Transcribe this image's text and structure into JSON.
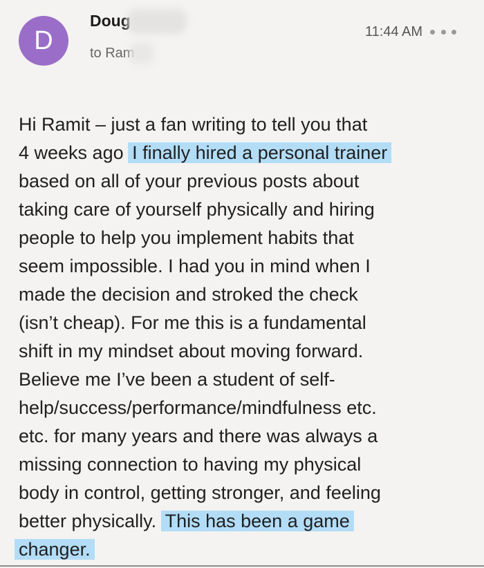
{
  "email": {
    "avatar_letter": "D",
    "sender_name": "Doug",
    "recipient": "to Ram",
    "time": "11:44 AM",
    "body_lines": [
      {
        "text": "Hi Ramit – just a fan writing to tell you that",
        "highlight": ""
      },
      {
        "text": "4 weeks ago ",
        "highlight": "I finally hired a personal trainer"
      },
      {
        "text": "based on all of your previous posts about",
        "highlight": ""
      },
      {
        "text": "taking care of yourself physically and hiring",
        "highlight": ""
      },
      {
        "text": "people to help you implement habits that",
        "highlight": ""
      },
      {
        "text": "seem impossible. I had you in mind when I",
        "highlight": ""
      },
      {
        "text": "made the decision and stroked the check",
        "highlight": ""
      },
      {
        "text": "(isn’t cheap). For me this is a fundamental",
        "highlight": ""
      },
      {
        "text": "shift in my mindset about moving forward.",
        "highlight": ""
      },
      {
        "text": "Believe me I’ve been a student of self-",
        "highlight": ""
      },
      {
        "text": "help/success/performance/mindfulness etc.",
        "highlight": ""
      },
      {
        "text": "etc. for many years and there was always a",
        "highlight": ""
      },
      {
        "text": "missing connection to having my physical",
        "highlight": ""
      },
      {
        "text": "body in control, getting stronger, and feeling",
        "highlight": ""
      },
      {
        "text": "better physically. ",
        "highlight": "This has been a game"
      },
      {
        "text": "",
        "highlight": "changer."
      }
    ]
  },
  "colors": {
    "avatar": "#9a6ec8",
    "highlight": "#b3ddf7",
    "background": "#f4f3f1"
  },
  "icons": {
    "more": "more-horizontal-icon"
  }
}
